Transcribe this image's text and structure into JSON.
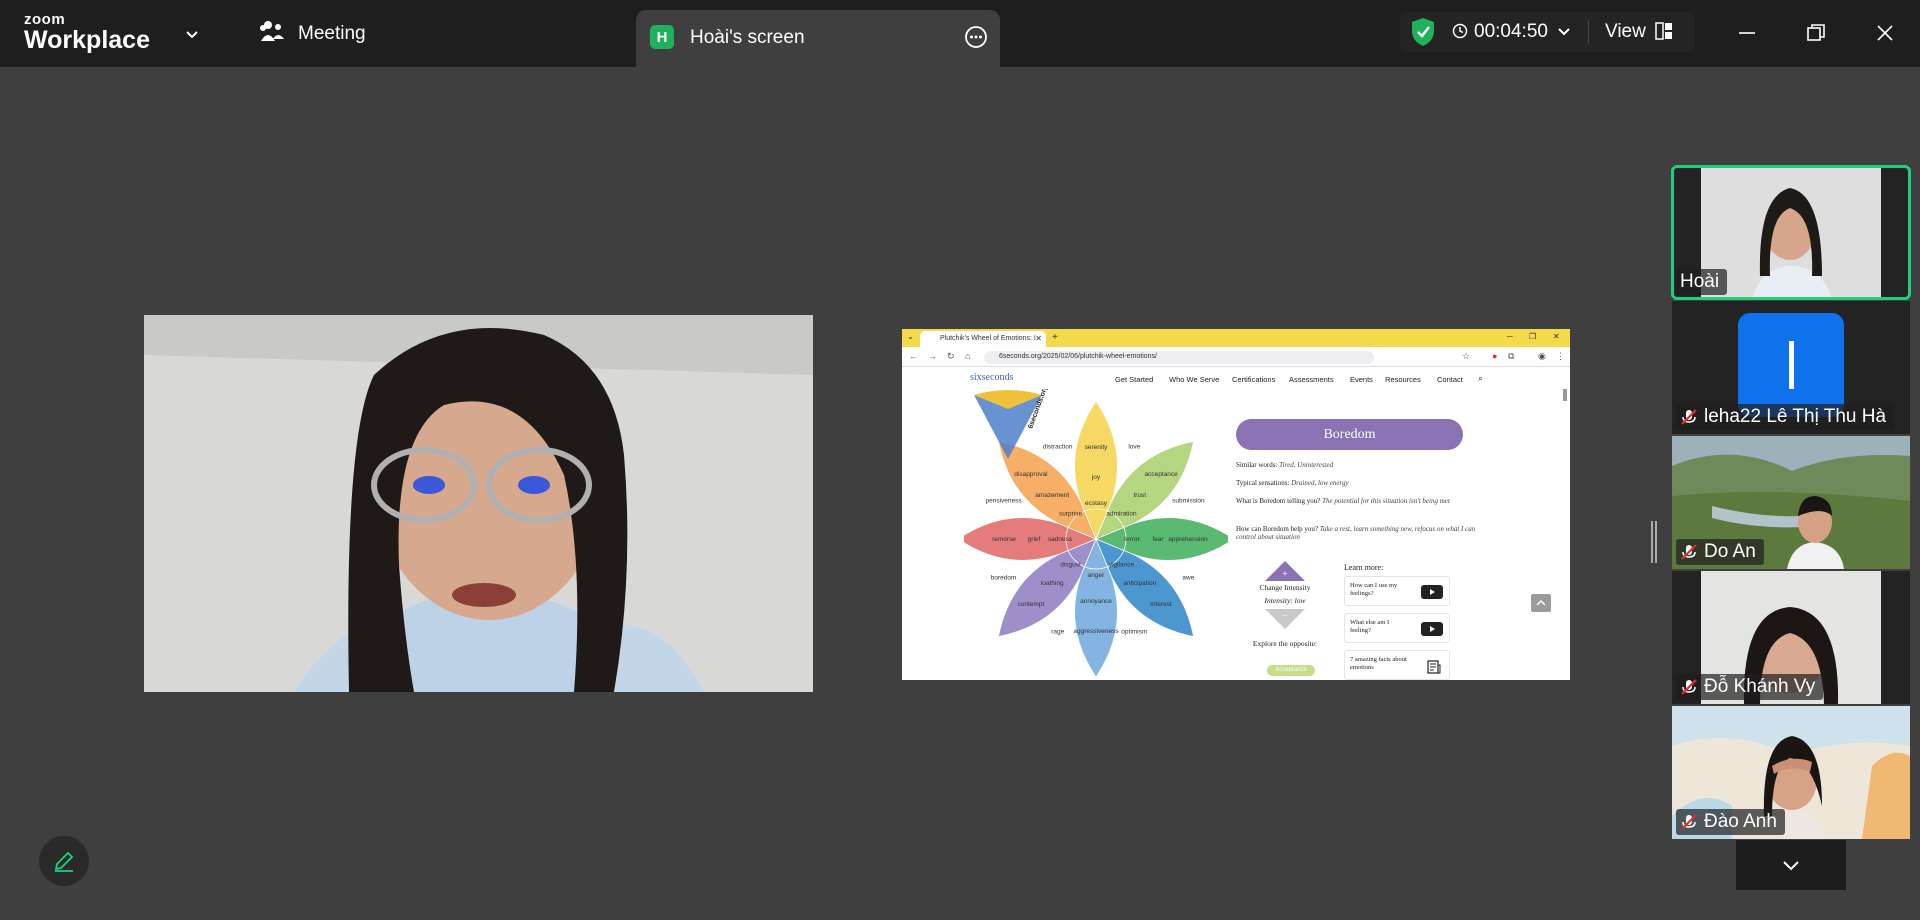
{
  "app": {
    "logo_line1": "zoom",
    "logo_line2": "Workplace",
    "accent_color": "#1fd07b"
  },
  "toolbar": {
    "meeting_label": "Meeting",
    "share_tab": {
      "initial": "H",
      "label": "Hoài's screen"
    },
    "timer": "00:04:50",
    "view_label": "View"
  },
  "shared_screen": {
    "browser_tab_title": "Plutchik's Wheel of Emotions: I",
    "url": "6seconds.org/2025/02/06/plutchik-wheel-emotions/",
    "site_logo": "sixseconds",
    "nav_items": [
      "Get Started",
      "Who We Serve",
      "Certifications",
      "Assessments",
      "Events",
      "Resources",
      "Contact"
    ],
    "emotion_title": "Boredom",
    "similar_label": "Similar words:",
    "similar_value": "Tired, Uninterested",
    "sensations_label": "Typical sensations:",
    "sensations_value": "Drained, low energy",
    "telling_label": "What is Boredom telling you?",
    "telling_value": "The potential for this situation isn't being met",
    "help_label": "How can Boredom help you?",
    "help_value": "Take a rest, learn something new, refocus on what I can control about situation",
    "change_intensity": "Change Intensity",
    "intensity_value": "Intensity: low",
    "explore_opposite": "Explore the opposite:",
    "opposite_value": "Acceptance",
    "learn_more": "Learn more:",
    "learn_cards": [
      "How can I use my feelings?",
      "What else am I feeling?",
      "7 amazing facts about emotions"
    ],
    "wheel_label": "6seconds.org",
    "wheel_words": [
      "serenity",
      "joy",
      "ecstasy",
      "love",
      "acceptance",
      "trust",
      "admiration",
      "submission",
      "apprehension",
      "fear",
      "terror",
      "awe",
      "interest",
      "anticipation",
      "vigilance",
      "optimism",
      "aggressiveness",
      "annoyance",
      "anger",
      "rage",
      "contempt",
      "loathing",
      "disgust",
      "boredom",
      "remorse",
      "grief",
      "sadness",
      "pensiveness",
      "disapproval",
      "amazement",
      "surprise",
      "distraction"
    ]
  },
  "participants": [
    {
      "name": "Hoài",
      "muted": false,
      "active": true
    },
    {
      "name": "leha22 Lê Thị Thu Hà",
      "muted": true,
      "avatar_letter": "l",
      "avatar_color": "#0e72ed"
    },
    {
      "name": "Do An",
      "muted": true
    },
    {
      "name": "Đỗ Khánh Vy",
      "muted": true
    },
    {
      "name": "Đào Anh",
      "muted": true
    }
  ]
}
